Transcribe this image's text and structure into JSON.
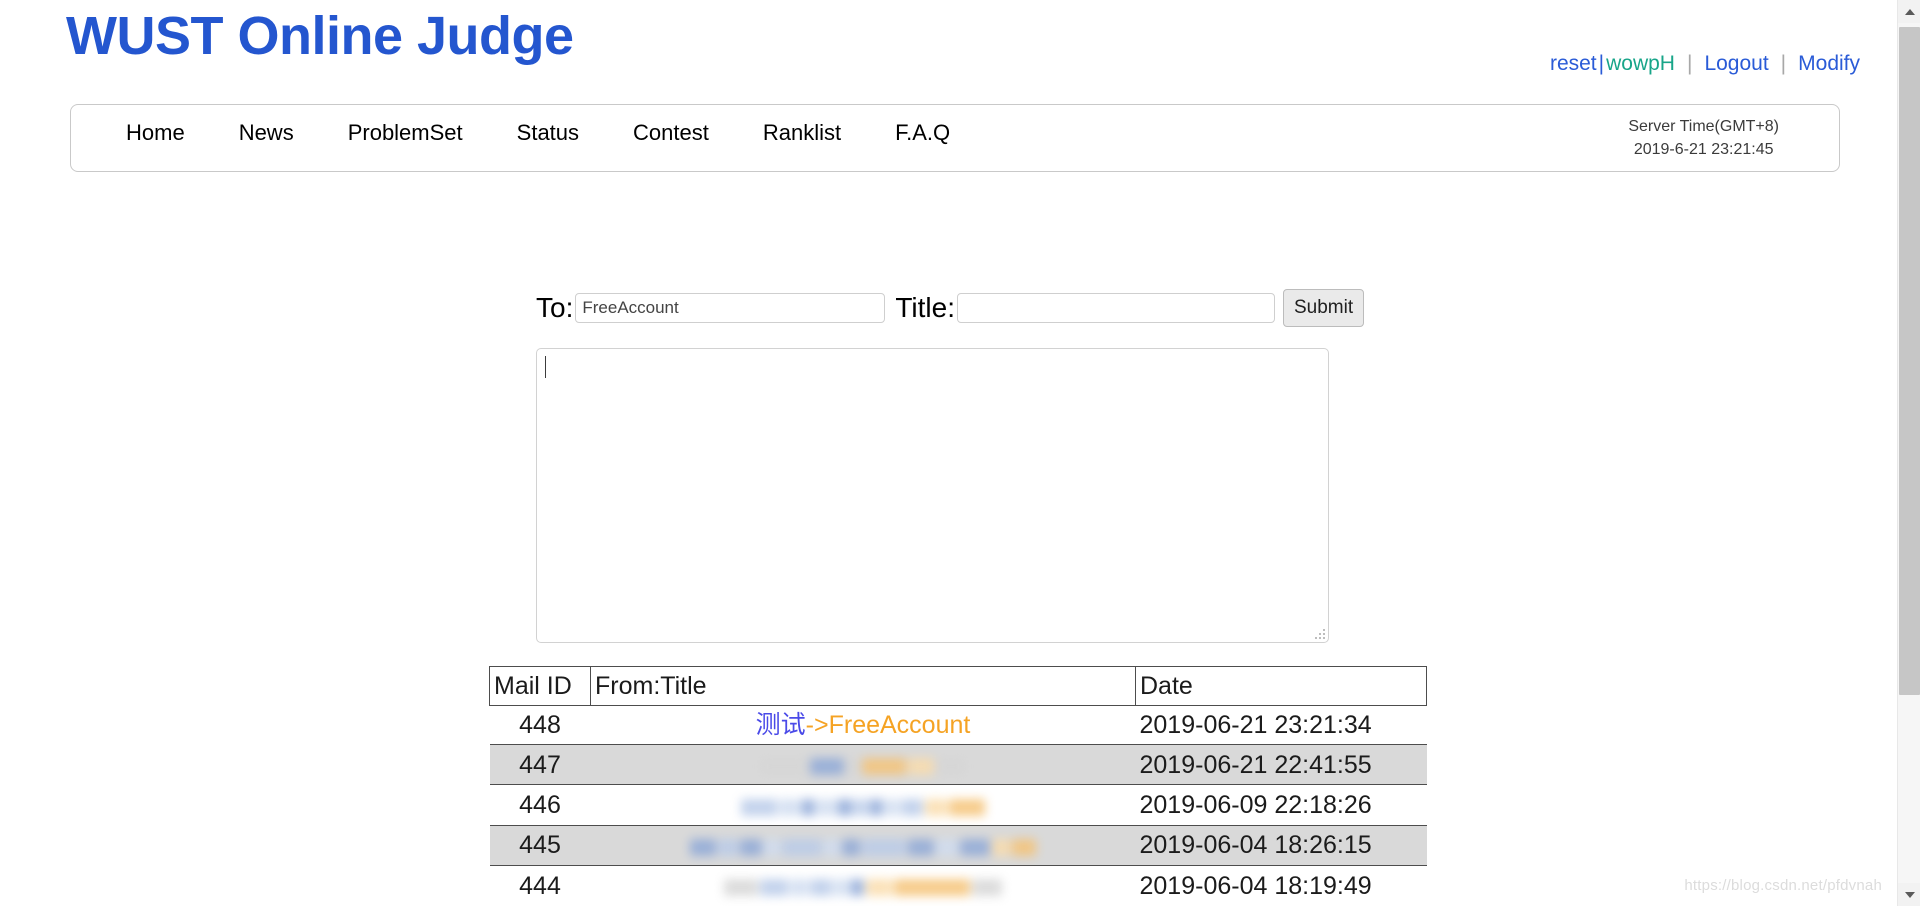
{
  "site": {
    "title": "WUST Online Judge",
    "title_color": "#2456cf"
  },
  "user_links": {
    "reset": "reset",
    "separator_thin": "|",
    "username": "wowpH",
    "username_color": "#18a589",
    "separator_grey": "|",
    "logout": "Logout",
    "modify": "Modify"
  },
  "nav": {
    "items": [
      {
        "label": "Home"
      },
      {
        "label": "News"
      },
      {
        "label": "ProblemSet"
      },
      {
        "label": "Status"
      },
      {
        "label": "Contest"
      },
      {
        "label": "Ranklist"
      },
      {
        "label": "F.A.Q"
      }
    ],
    "server_time_label": "Server Time(GMT+8)",
    "server_time_value": "2019-6-21 23:21:45"
  },
  "compose": {
    "to_label": "To:",
    "to_value": "FreeAccount",
    "to_placeholder": "",
    "title_label": "Title:",
    "title_value": "",
    "title_placeholder": "",
    "submit_label": "Submit",
    "body_value": "",
    "body_placeholder": ""
  },
  "mail_table": {
    "headers": {
      "id": "Mail ID",
      "title": "From:Title",
      "date": "Date"
    },
    "rows": [
      {
        "id": "448",
        "from": "测试",
        "arrow_to": "->FreeAccount",
        "redacted": false,
        "date": "2019-06-21 23:21:34"
      },
      {
        "id": "447",
        "from": "",
        "arrow_to": "",
        "redacted": true,
        "date": "2019-06-21 22:41:55"
      },
      {
        "id": "446",
        "from": "",
        "arrow_to": "",
        "redacted": true,
        "date": "2019-06-09 22:18:26"
      },
      {
        "id": "445",
        "from": "",
        "arrow_to": "",
        "redacted": true,
        "date": "2019-06-04 18:26:15"
      },
      {
        "id": "444",
        "from": "",
        "arrow_to": "",
        "redacted": true,
        "date": "2019-06-04 18:19:49"
      }
    ],
    "link_from_color": "#4a4ae8",
    "link_to_color": "#f5a324",
    "alt_row_color": "#d9d9d9"
  },
  "watermark": {
    "text": "https://blog.csdn.net/pfdvnah"
  }
}
